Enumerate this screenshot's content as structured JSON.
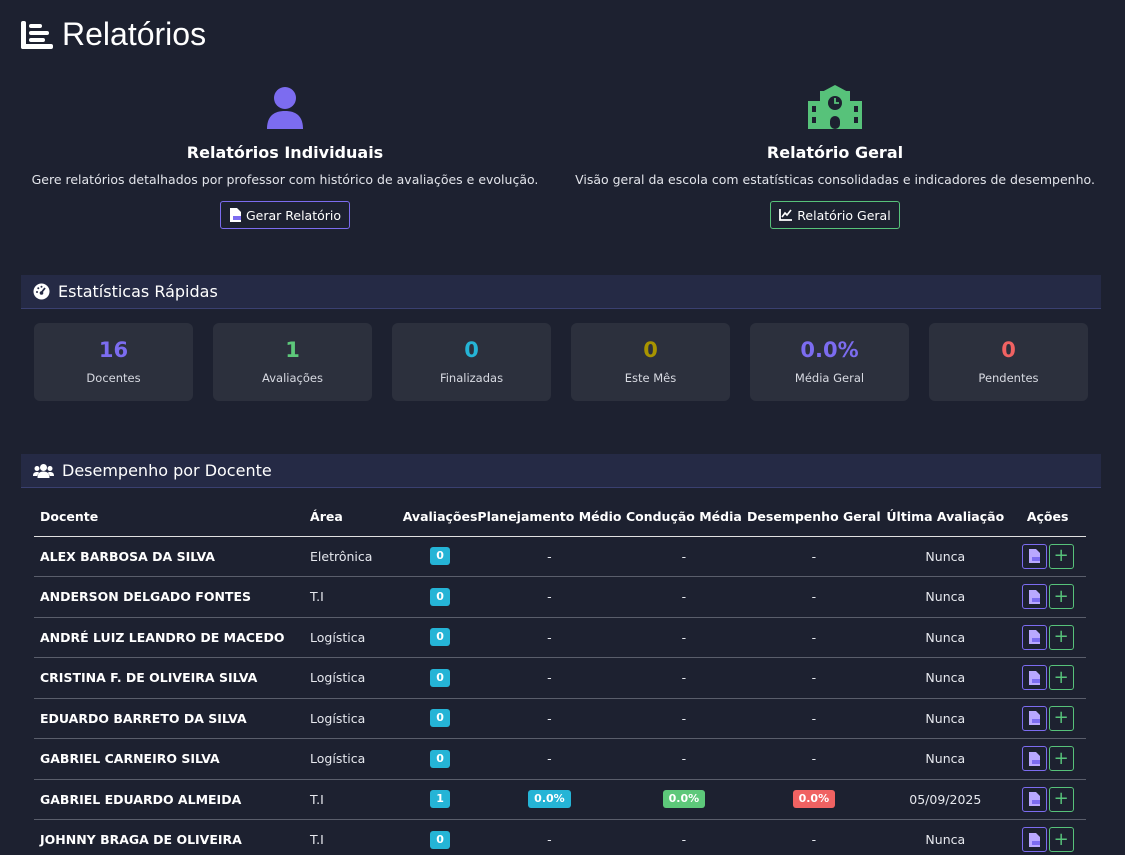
{
  "header": {
    "title": "Relatórios",
    "icon": "list-icon"
  },
  "cards": {
    "individual": {
      "title": "Relatórios Individuais",
      "description": "Gere relatórios detalhados por professor com histórico de avaliações e evolução.",
      "button": "Gerar Relatório",
      "icon": "user-icon",
      "color": "#7c6cf0"
    },
    "general": {
      "title": "Relatório Geral",
      "description": "Visão geral da escola com estatísticas consolidadas e indicadores de desempenho.",
      "button": "Relatório Geral",
      "icon": "school-icon",
      "color": "#57c27a"
    }
  },
  "stats_section": {
    "title": "Estatísticas Rápidas",
    "icon": "gauge-icon",
    "items": [
      {
        "value": "16",
        "label": "Docentes",
        "color": "#7c6cf0"
      },
      {
        "value": "1",
        "label": "Avaliações",
        "color": "#5dc87a"
      },
      {
        "value": "0",
        "label": "Finalizadas",
        "color": "#25b4d6"
      },
      {
        "value": "0",
        "label": "Este Mês",
        "color": "#a89400"
      },
      {
        "value": "0.0%",
        "label": "Média Geral",
        "color": "#7c6cf0"
      },
      {
        "value": "0",
        "label": "Pendentes",
        "color": "#f06262"
      }
    ]
  },
  "performance_section": {
    "title": "Desempenho por Docente",
    "icon": "users-icon",
    "columns": [
      "Docente",
      "Área",
      "Avaliações",
      "Planejamento Médio",
      "Condução Média",
      "Desempenho Geral",
      "Última Avaliação",
      "Ações"
    ],
    "rows": [
      {
        "name": "ALEX BARBOSA DA SILVA",
        "area": "Eletrônica",
        "evaluations": "0",
        "planning": "-",
        "conduct": "-",
        "overall": "-",
        "last": "Nunca"
      },
      {
        "name": "ANDERSON DELGADO FONTES",
        "area": "T.I",
        "evaluations": "0",
        "planning": "-",
        "conduct": "-",
        "overall": "-",
        "last": "Nunca"
      },
      {
        "name": "ANDRÉ LUIZ LEANDRO DE MACEDO",
        "area": "Logística",
        "evaluations": "0",
        "planning": "-",
        "conduct": "-",
        "overall": "-",
        "last": "Nunca"
      },
      {
        "name": "CRISTINA F. DE OLIVEIRA SILVA",
        "area": "Logística",
        "evaluations": "0",
        "planning": "-",
        "conduct": "-",
        "overall": "-",
        "last": "Nunca"
      },
      {
        "name": "EDUARDO BARRETO DA SILVA",
        "area": "Logística",
        "evaluations": "0",
        "planning": "-",
        "conduct": "-",
        "overall": "-",
        "last": "Nunca"
      },
      {
        "name": "GABRIEL CARNEIRO SILVA",
        "area": "Logística",
        "evaluations": "0",
        "planning": "-",
        "conduct": "-",
        "overall": "-",
        "last": "Nunca"
      },
      {
        "name": "GABRIEL EDUARDO ALMEIDA",
        "area": "T.I",
        "evaluations": "1",
        "planning": "0.0%",
        "conduct": "0.0%",
        "overall": "0.0%",
        "last": "05/09/2025"
      },
      {
        "name": "JOHNNY BRAGA DE OLIVEIRA",
        "area": "T.I",
        "evaluations": "0",
        "planning": "-",
        "conduct": "-",
        "overall": "-",
        "last": "Nunca"
      }
    ],
    "action_icons": [
      "file-pdf-icon",
      "plus-icon"
    ]
  }
}
